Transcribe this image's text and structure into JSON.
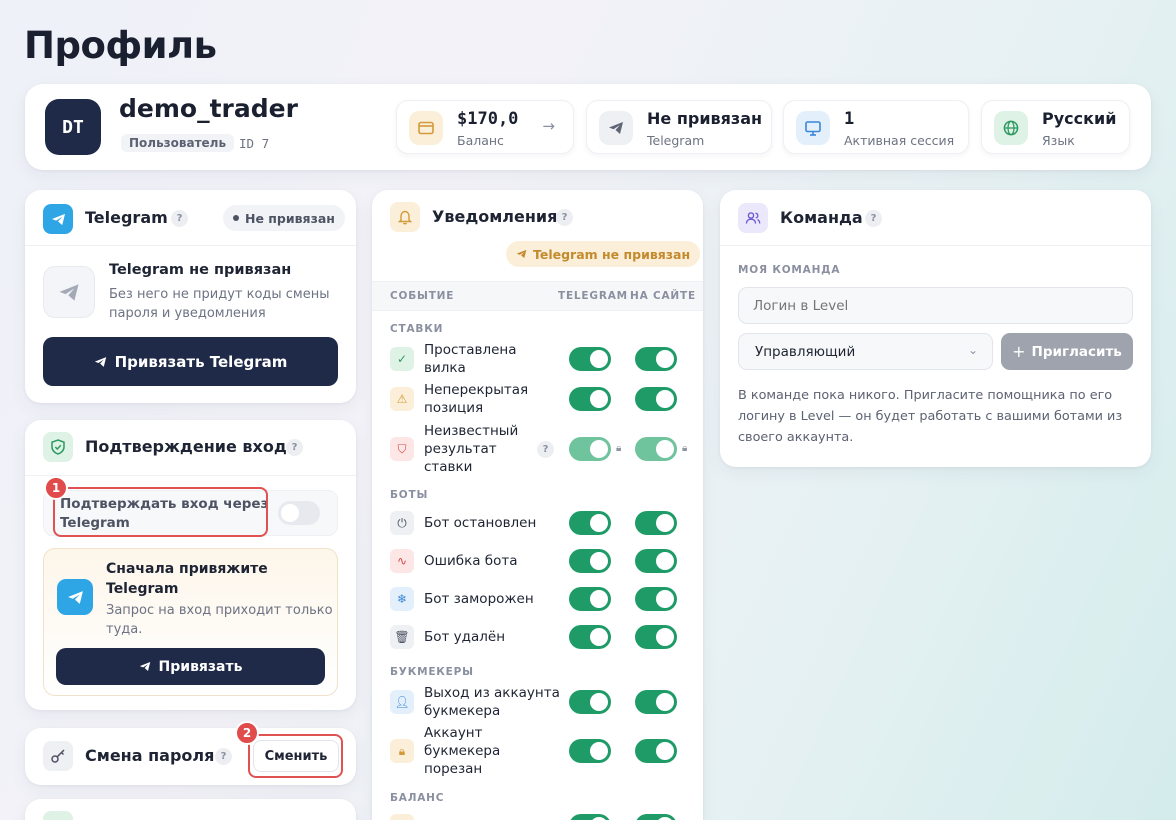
{
  "page": {
    "title": "Профиль"
  },
  "profile": {
    "avatar_initials": "DT",
    "username": "demo_trader",
    "role": "Пользователь",
    "id_label": "ID 7"
  },
  "stats": {
    "balance": {
      "value": "$170,0",
      "label": "Баланс"
    },
    "telegram": {
      "value": "Не привязан",
      "label": "Telegram"
    },
    "sessions": {
      "value": "1",
      "label": "Активная сессия"
    },
    "language": {
      "value": "Русский",
      "label": "Язык"
    }
  },
  "telegram_card": {
    "title": "Telegram",
    "help": "?",
    "status_badge": "Не привязан",
    "heading": "Telegram не привязан",
    "desc_line1": "Без него не придут коды смены",
    "desc_line2": "пароля и уведомления",
    "button": "Привязать Telegram"
  },
  "login_confirm": {
    "title": "Подтверждение входа",
    "help": "?",
    "toggle_label_line1": "Подтверждать вход через",
    "toggle_label_line2": "Telegram",
    "toggle_on": false,
    "notice_title_line1": "Сначала привяжите",
    "notice_title_line2": "Telegram",
    "notice_desc_line1": "Запрос на вход приходит только",
    "notice_desc_line2": "туда.",
    "button": "Привязать",
    "step_badge": "1"
  },
  "password": {
    "title": "Смена пароля",
    "help": "?",
    "button": "Сменить",
    "step_badge": "2"
  },
  "notifications": {
    "title": "Уведомления",
    "help": "?",
    "telegram_badge": "Telegram не привязан",
    "col_event": "СОБЫТИЕ",
    "col_telegram": "TELEGRAM",
    "col_site": "НА САЙТЕ",
    "sections": [
      {
        "label": "СТАВКИ"
      },
      {
        "label": "БОТЫ"
      },
      {
        "label": "БУКМЕКЕРЫ"
      },
      {
        "label": "БАЛАНС"
      }
    ],
    "rows": [
      {
        "line1": "Проставлена",
        "line2": "вилка",
        "icon": "check-icon",
        "telegram": true,
        "site": true
      },
      {
        "line1": "Неперекрытая",
        "line2": "позиция",
        "icon": "warning-icon",
        "telegram": true,
        "site": true
      },
      {
        "line1": "Неизвестный",
        "line2": "результат",
        "line3": "ставки",
        "icon": "shield-alert-icon",
        "help": "?",
        "telegram": true,
        "site": true,
        "locked": true
      },
      {
        "line1": "Бот остановлен",
        "icon": "power-icon",
        "telegram": true,
        "site": true
      },
      {
        "line1": "Ошибка бота",
        "icon": "pulse-icon",
        "telegram": true,
        "site": true
      },
      {
        "line1": "Бот заморожен",
        "icon": "snowflake-icon",
        "telegram": true,
        "site": true
      },
      {
        "line1": "Бот удалён",
        "icon": "trash-icon",
        "telegram": true,
        "site": true
      },
      {
        "line1": "Выход из аккаунта",
        "line2": "букмекера",
        "icon": "user-icon",
        "telegram": true,
        "site": true
      },
      {
        "line1": "Аккаунт",
        "line2": "букмекера",
        "line3": "порезан",
        "icon": "lock-icon",
        "telegram": true,
        "site": true
      }
    ]
  },
  "team": {
    "title": "Команда",
    "help": "?",
    "section_label": "МОЯ КОМАНДА",
    "login_placeholder": "Логин в Level",
    "role_selected": "Управляющий",
    "invite_button": "Пригласить",
    "info_line1": "В команде пока никого. Пригласите помощника по его",
    "info_line2": "логину в Level — он будет работать с вашими ботами из",
    "info_line3": "своего аккаунта."
  },
  "colors": {
    "accent_dark": "#1e2a47",
    "toggle_on": "#1f9b68",
    "highlight_red": "#e05252"
  }
}
